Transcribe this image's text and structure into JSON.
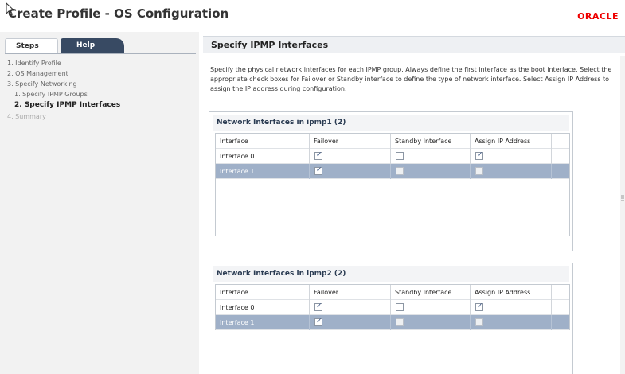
{
  "header": {
    "title": "Create Profile - OS Configuration",
    "logo": "ORACLE"
  },
  "sidebar": {
    "tabs": {
      "steps": "Steps",
      "help": "Help"
    },
    "steps": [
      {
        "label": "1.  Identify Profile",
        "state": "done"
      },
      {
        "label": "2.  OS Management",
        "state": "done"
      },
      {
        "label": "3.  Specify Networking",
        "state": "done"
      },
      {
        "label": "1.  Specify IPMP Groups",
        "state": "done"
      },
      {
        "label": "2.  Specify IPMP Interfaces",
        "state": "current"
      },
      {
        "label": "4.  Summary",
        "state": "pending"
      }
    ]
  },
  "main": {
    "title": "Specify IPMP Interfaces",
    "description": "Specify the physical network interfaces for each IPMP group. Always define the first interface as the boot interface. Select the appropriate check boxes for Failover or Standby interface to define the type of network interface. Select Assign IP Address to assign the IP address during configuration.",
    "columns": [
      "Interface",
      "Failover",
      "Standby Interface",
      "Assign IP Address"
    ],
    "panels": [
      {
        "title": "Network Interfaces in ipmp1 (2)",
        "rows": [
          {
            "interface": "Interface 0",
            "failover": true,
            "standby": false,
            "assign_ip": true,
            "selected": false
          },
          {
            "interface": "Interface 1",
            "failover": true,
            "standby": false,
            "assign_ip": false,
            "selected": true
          }
        ]
      },
      {
        "title": "Network Interfaces in ipmp2 (2)",
        "rows": [
          {
            "interface": "Interface 0",
            "failover": true,
            "standby": false,
            "assign_ip": true,
            "selected": false
          },
          {
            "interface": "Interface 1",
            "failover": true,
            "standby": false,
            "assign_ip": false,
            "selected": true
          }
        ]
      }
    ]
  }
}
